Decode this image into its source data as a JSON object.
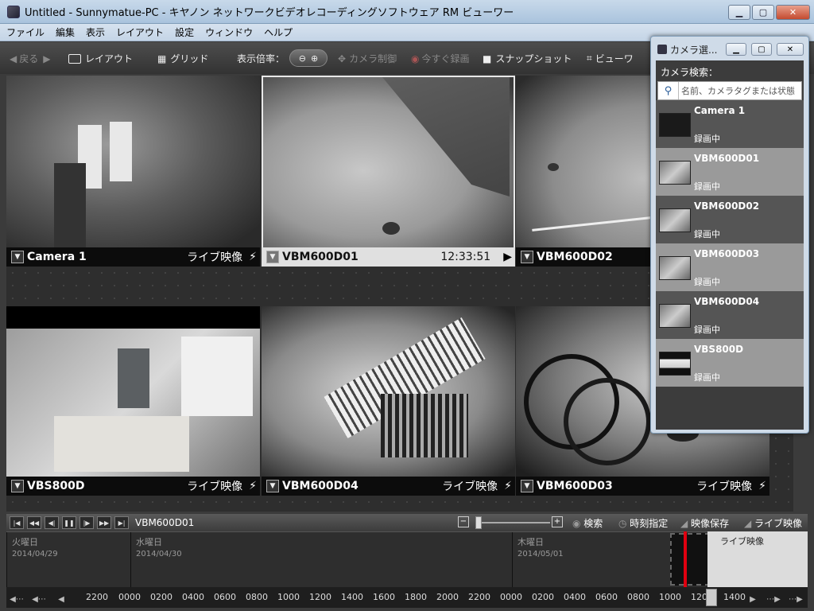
{
  "window": {
    "title": "Untitled - Sunnymatue-PC - キヤノン ネットワークビデオレコーディングソフトウェア RM ビューワー",
    "minimize": "▁",
    "maximize": "▢",
    "close": "✕"
  },
  "menu": [
    "ファイル",
    "編集",
    "表示",
    "レイアウト",
    "設定",
    "ウィンドウ",
    "ヘルプ"
  ],
  "toolbar": {
    "back": "戻る",
    "layout": "レイアウト",
    "grid": "グリッド",
    "zoom_label": "表示倍率：",
    "camera_control": "カメラ制御",
    "record_now": "今すぐ録画",
    "snapshot": "スナップショット",
    "viewer": "ビューワ"
  },
  "tiles": [
    {
      "name": "Camera 1",
      "status": "ライブ映像",
      "selected": false
    },
    {
      "name": "VBM600D01",
      "status": "12:33:51",
      "selected": true
    },
    {
      "name": "VBM600D02",
      "status": "",
      "selected": false
    },
    {
      "name": "VBS800D",
      "status": "ライブ映像",
      "selected": false
    },
    {
      "name": "VBM600D04",
      "status": "ライブ映像",
      "selected": false
    },
    {
      "name": "VBM600D03",
      "status": "ライブ映像",
      "selected": false
    }
  ],
  "camera_selector": {
    "title": "カメラ選...",
    "search_label": "カメラ検索：",
    "search_placeholder": "名前、カメラタグまたは状態",
    "cameras": [
      {
        "name": "Camera 1",
        "status": "録画中"
      },
      {
        "name": "VBM600D01",
        "status": "録画中"
      },
      {
        "name": "VBM600D02",
        "status": "録画中"
      },
      {
        "name": "VBM600D03",
        "status": "録画中"
      },
      {
        "name": "VBM600D04",
        "status": "録画中"
      },
      {
        "name": "VBS800D",
        "status": "録画中"
      }
    ]
  },
  "playback": {
    "camera": "VBM600D01",
    "search": "検索",
    "time_spec": "時刻指定",
    "save_video": "映像保存",
    "live_video": "ライブ映像"
  },
  "timeline": {
    "days": [
      {
        "weekday": "火曜日",
        "date": "2014/04/29"
      },
      {
        "weekday": "水曜日",
        "date": "2014/04/30"
      },
      {
        "weekday": "木曜日",
        "date": "2014/05/01"
      }
    ],
    "live_label": "ライブ映像",
    "ticks": [
      "2200",
      "0000",
      "0200",
      "0400",
      "0600",
      "0800",
      "1000",
      "1200",
      "1400",
      "1600",
      "1800",
      "2000",
      "2200",
      "0000",
      "0200",
      "0400",
      "0600",
      "0800",
      "1000",
      "120",
      "1400"
    ]
  }
}
